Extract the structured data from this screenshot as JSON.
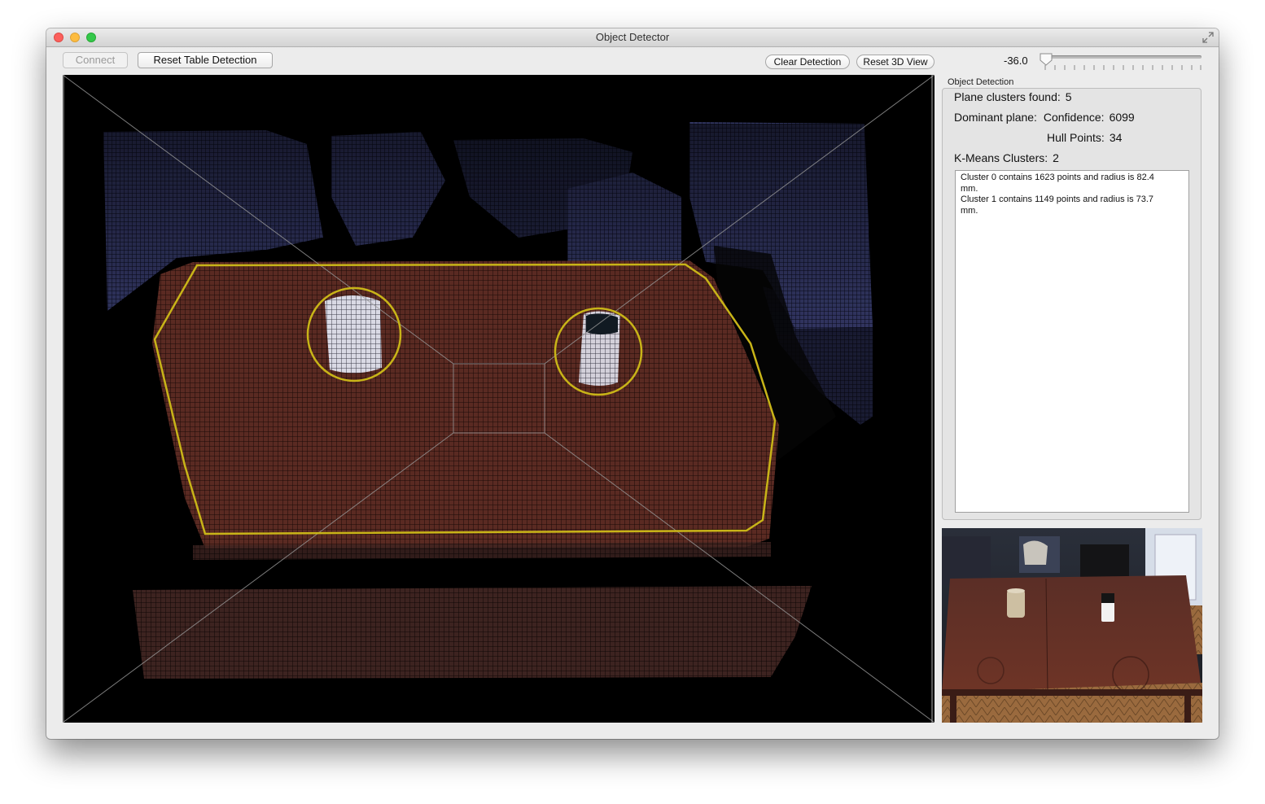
{
  "window": {
    "title": "Object Detector"
  },
  "toolbar": {
    "connect_label": "Connect",
    "reset_table_label": "Reset Table Detection",
    "clear_detection_label": "Clear Detection",
    "reset_3d_label": "Reset 3D View",
    "slider_value": "-36.0"
  },
  "panel": {
    "group_label": "Object Detection",
    "plane_clusters_label": "Plane clusters found:",
    "plane_clusters_value": "5",
    "dominant_plane_label": "Dominant plane:",
    "confidence_label": "Confidence:",
    "confidence_value": "6099",
    "hull_points_label": "Hull Points:",
    "hull_points_value": "34",
    "kmeans_label": "K-Means Clusters:",
    "kmeans_value": "2",
    "log_lines": [
      "Cluster 0 contains 1623 points and radius is 82.4",
      "mm.",
      "Cluster 1 contains 1149 points and radius is 73.7",
      "mm."
    ]
  },
  "colors": {
    "hull_outline": "#c8b418",
    "table_points": "#6a2f24",
    "background_points": "#4a4f86"
  },
  "icons": {
    "fullscreen": "fullscreen-icon",
    "slider_knob": "slider-knob-icon"
  }
}
